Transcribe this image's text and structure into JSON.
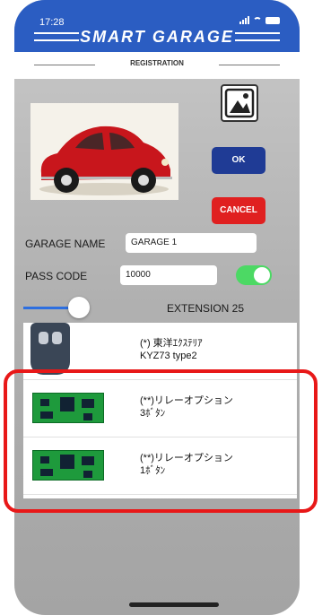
{
  "status_bar": {
    "time": "17:28"
  },
  "header": {
    "app_title": "SMART GARAGE",
    "section_title": "REGISTRATION"
  },
  "buttons": {
    "ok": "OK",
    "cancel": "CANCEL"
  },
  "form": {
    "garage_name_label": "GARAGE NAME",
    "garage_name_value": "GARAGE 1",
    "pass_code_label": "PASS CODE",
    "pass_code_value": "10000",
    "pass_code_toggle_on": true
  },
  "extension": {
    "label": "EXTENSION 25"
  },
  "device_list": [
    {
      "line1": "(*) 東洋ｴｸｽﾃﾘｱ",
      "line2": "KYZ73 type2",
      "icon": "remote-control-icon"
    },
    {
      "line1": "(**)リレーオプション",
      "line2": "3ﾎﾞﾀﾝ",
      "icon": "relay-board-icon"
    },
    {
      "line1": "(**)リレーオプション",
      "line2": "1ﾎﾞﾀﾝ",
      "icon": "relay-board-icon"
    }
  ],
  "colors": {
    "header_blue": "#2b5dc2",
    "ok_blue": "#1f3b95",
    "cancel_red": "#e02020",
    "toggle_green": "#4cd964",
    "highlight_red": "#e81818"
  }
}
